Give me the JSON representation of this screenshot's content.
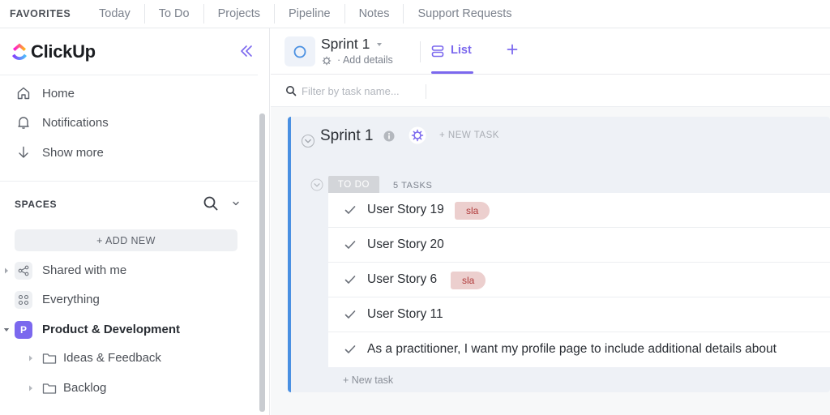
{
  "favorites": {
    "title": "FAVORITES",
    "items": [
      "Today",
      "To Do",
      "Projects",
      "Pipeline",
      "Notes",
      "Support Requests"
    ]
  },
  "sidebar": {
    "app_name": "ClickUp",
    "nav": [
      {
        "label": "Home",
        "icon": "home-icon"
      },
      {
        "label": "Notifications",
        "icon": "bell-icon"
      },
      {
        "label": "Show more",
        "icon": "arrow-down-icon"
      }
    ],
    "spaces_title": "SPACES",
    "add_new": "+ ADD NEW",
    "tree": {
      "shared": "Shared with me",
      "everything": "Everything",
      "space": {
        "badge": "P",
        "label": "Product & Development",
        "color": "#7b68ee"
      },
      "folders": [
        "Ideas & Feedback",
        "Backlog"
      ]
    }
  },
  "header": {
    "title": "Sprint 1",
    "add_details": "Add details",
    "view_tab": "List",
    "accent": "#7b68ee"
  },
  "filter": {
    "placeholder": "Filter by task name..."
  },
  "group": {
    "title": "Sprint 1",
    "new_task": "+ NEW TASK",
    "status": "TO DO",
    "count": "5 TASKS",
    "bar_color": "#4a90e2",
    "tasks": [
      {
        "name": "User Story 19",
        "tag": "sla"
      },
      {
        "name": "User Story 20",
        "tag": ""
      },
      {
        "name": "User Story 6",
        "tag": "sla"
      },
      {
        "name": "User Story 11",
        "tag": ""
      },
      {
        "name": "As a practitioner, I want my profile page to include additional details about",
        "tag": ""
      }
    ],
    "add_task": "+ New task"
  }
}
